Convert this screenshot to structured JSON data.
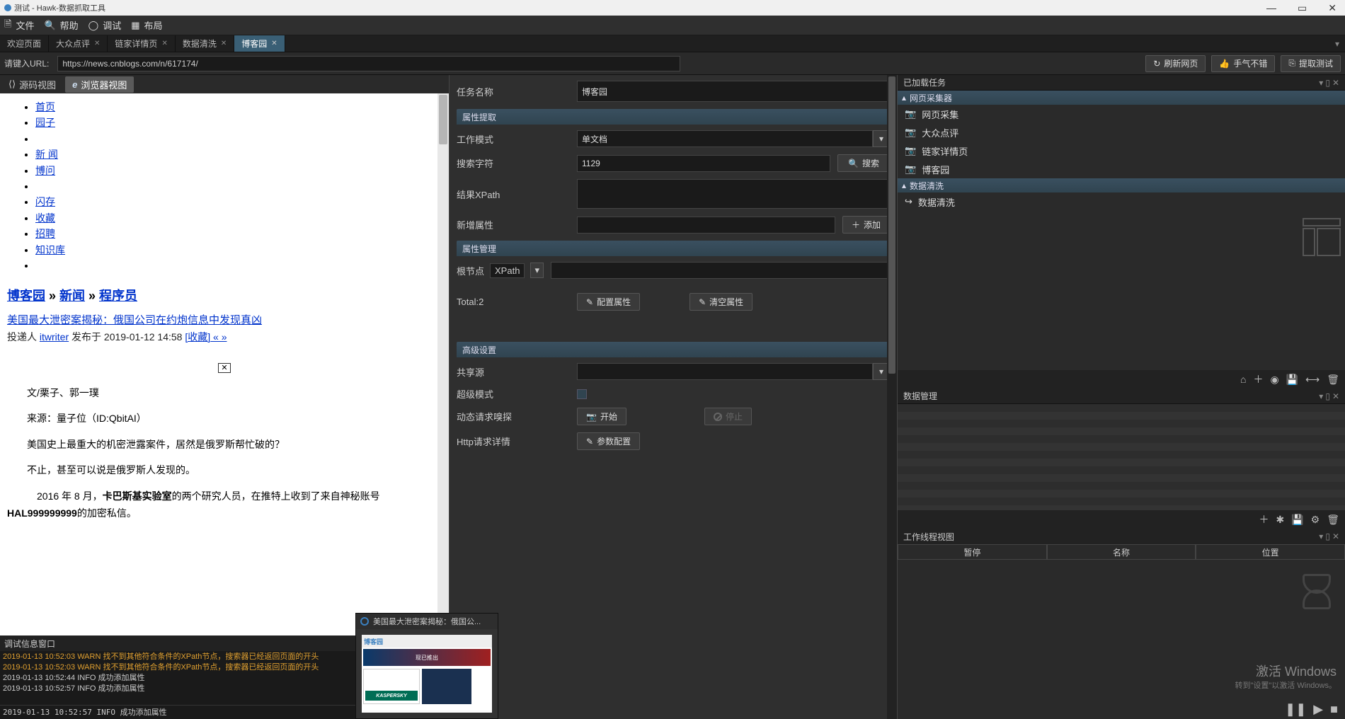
{
  "window": {
    "title": "测试 - Hawk-数据抓取工具"
  },
  "menubar": {
    "file": "文件",
    "help": "帮助",
    "debug": "调试",
    "layout": "布局"
  },
  "tabs": [
    {
      "label": "欢迎页面",
      "active": false,
      "closeable": false
    },
    {
      "label": "大众点评",
      "active": false,
      "closeable": true
    },
    {
      "label": "链家详情页",
      "active": false,
      "closeable": true
    },
    {
      "label": "数据清洗",
      "active": false,
      "closeable": true
    },
    {
      "label": "博客园",
      "active": true,
      "closeable": true
    }
  ],
  "urlbar": {
    "label": "请键入URL:",
    "value": "https://news.cnblogs.com/n/617174/",
    "refresh_btn": "刷新网页",
    "lucky_btn": "手气不错",
    "extract_btn": "提取测试"
  },
  "viewtoggle": {
    "source": "源码视图",
    "browser": "浏览器视图"
  },
  "browser": {
    "nav": [
      "首页",
      "园子",
      "",
      "新 闻",
      "博问",
      "",
      "闪存",
      "收藏",
      "招聘",
      "知识库",
      ""
    ],
    "crumb1": "博客园",
    "crumb2": "新闻",
    "crumb3": "程序员",
    "sep": " » ",
    "article_title": "美国最大泄密案揭秘：俄国公司在约炮信息中发现真凶",
    "byline_prefix": "投递人 ",
    "byline_user": "itwriter",
    "byline_mid": " 发布于 2019-01-12 14:58 ",
    "byline_fav": "[收藏]",
    "byline_nav": " « »",
    "p1": "文/栗子、郭一璞",
    "p2": "来源：量子位（ID:QbitAI）",
    "p3": "美国史上最重大的机密泄露案件，居然是俄罗斯帮忙破的？",
    "p4": "不止，甚至可以说是俄罗斯人发现的。",
    "p5_a": "　2016 年 8 月，",
    "p5_b": "卡巴斯基实验室",
    "p5_c": "的两个研究人员，在推特上收到了来自神秘账号",
    "p6_a": "HAL999999999",
    "p6_b": "的加密私信。"
  },
  "center": {
    "task_name_label": "任务名称",
    "task_name_value": "博客园",
    "sec_extract": "属性提取",
    "work_mode_label": "工作模式",
    "work_mode_value": "单文档",
    "search_label": "搜索字符",
    "search_value": "1129",
    "search_btn": "搜索",
    "result_xpath_label": "结果XPath",
    "new_attr_label": "新增属性",
    "add_btn": "添加",
    "sec_manage": "属性管理",
    "root_label": "根节点",
    "root_type": "XPath",
    "total_label": "Total:2",
    "config_attr_btn": "配置属性",
    "clear_attr_btn": "清空属性",
    "sec_advanced": "高级设置",
    "share_label": "共享源",
    "super_label": "超级模式",
    "sniff_label": "动态请求嗅探",
    "start_btn": "开始",
    "stop_btn": "停止",
    "http_label": "Http请求详情",
    "param_btn": "参数配置"
  },
  "right": {
    "loaded_tasks_title": "已加载任务",
    "sec_collector": "网页采集器",
    "items_collector": [
      "网页采集",
      "大众点评",
      "链家详情页",
      "博客园"
    ],
    "sec_clean": "数据清洗",
    "items_clean": [
      "数据清洗"
    ],
    "data_mgmt_title": "数据管理",
    "thread_view_title": "工作线程视图",
    "thread_cols": [
      "暂停",
      "名称",
      "位置"
    ],
    "watermark_line1": "激活 Windows",
    "watermark_line2": "转到\"设置\"以激活 Windows。"
  },
  "log": {
    "title": "调试信息窗口",
    "lines": [
      {
        "cls": "warn",
        "text": "2019-01-13 10:52:03 WARN  找不到其他符合条件的XPath节点，搜索器已经返回页面的开头"
      },
      {
        "cls": "warn",
        "text": "2019-01-13 10:52:03 WARN  找不到其他符合条件的XPath节点，搜索器已经返回页面的开头"
      },
      {
        "cls": "info",
        "text": "2019-01-13 10:52:44 INFO  成功添加属性"
      },
      {
        "cls": "info",
        "text": "2019-01-13 10:52:57 INFO  成功添加属性"
      }
    ],
    "footer": "2019-01-13 10:52:57 INFO  成功添加属性"
  },
  "floating": {
    "title": "美国最大泄密案揭秘：俄国公...",
    "logo_text": "博客园",
    "banner_text": "现已推出",
    "kasper_text": "KASPERSKY"
  }
}
